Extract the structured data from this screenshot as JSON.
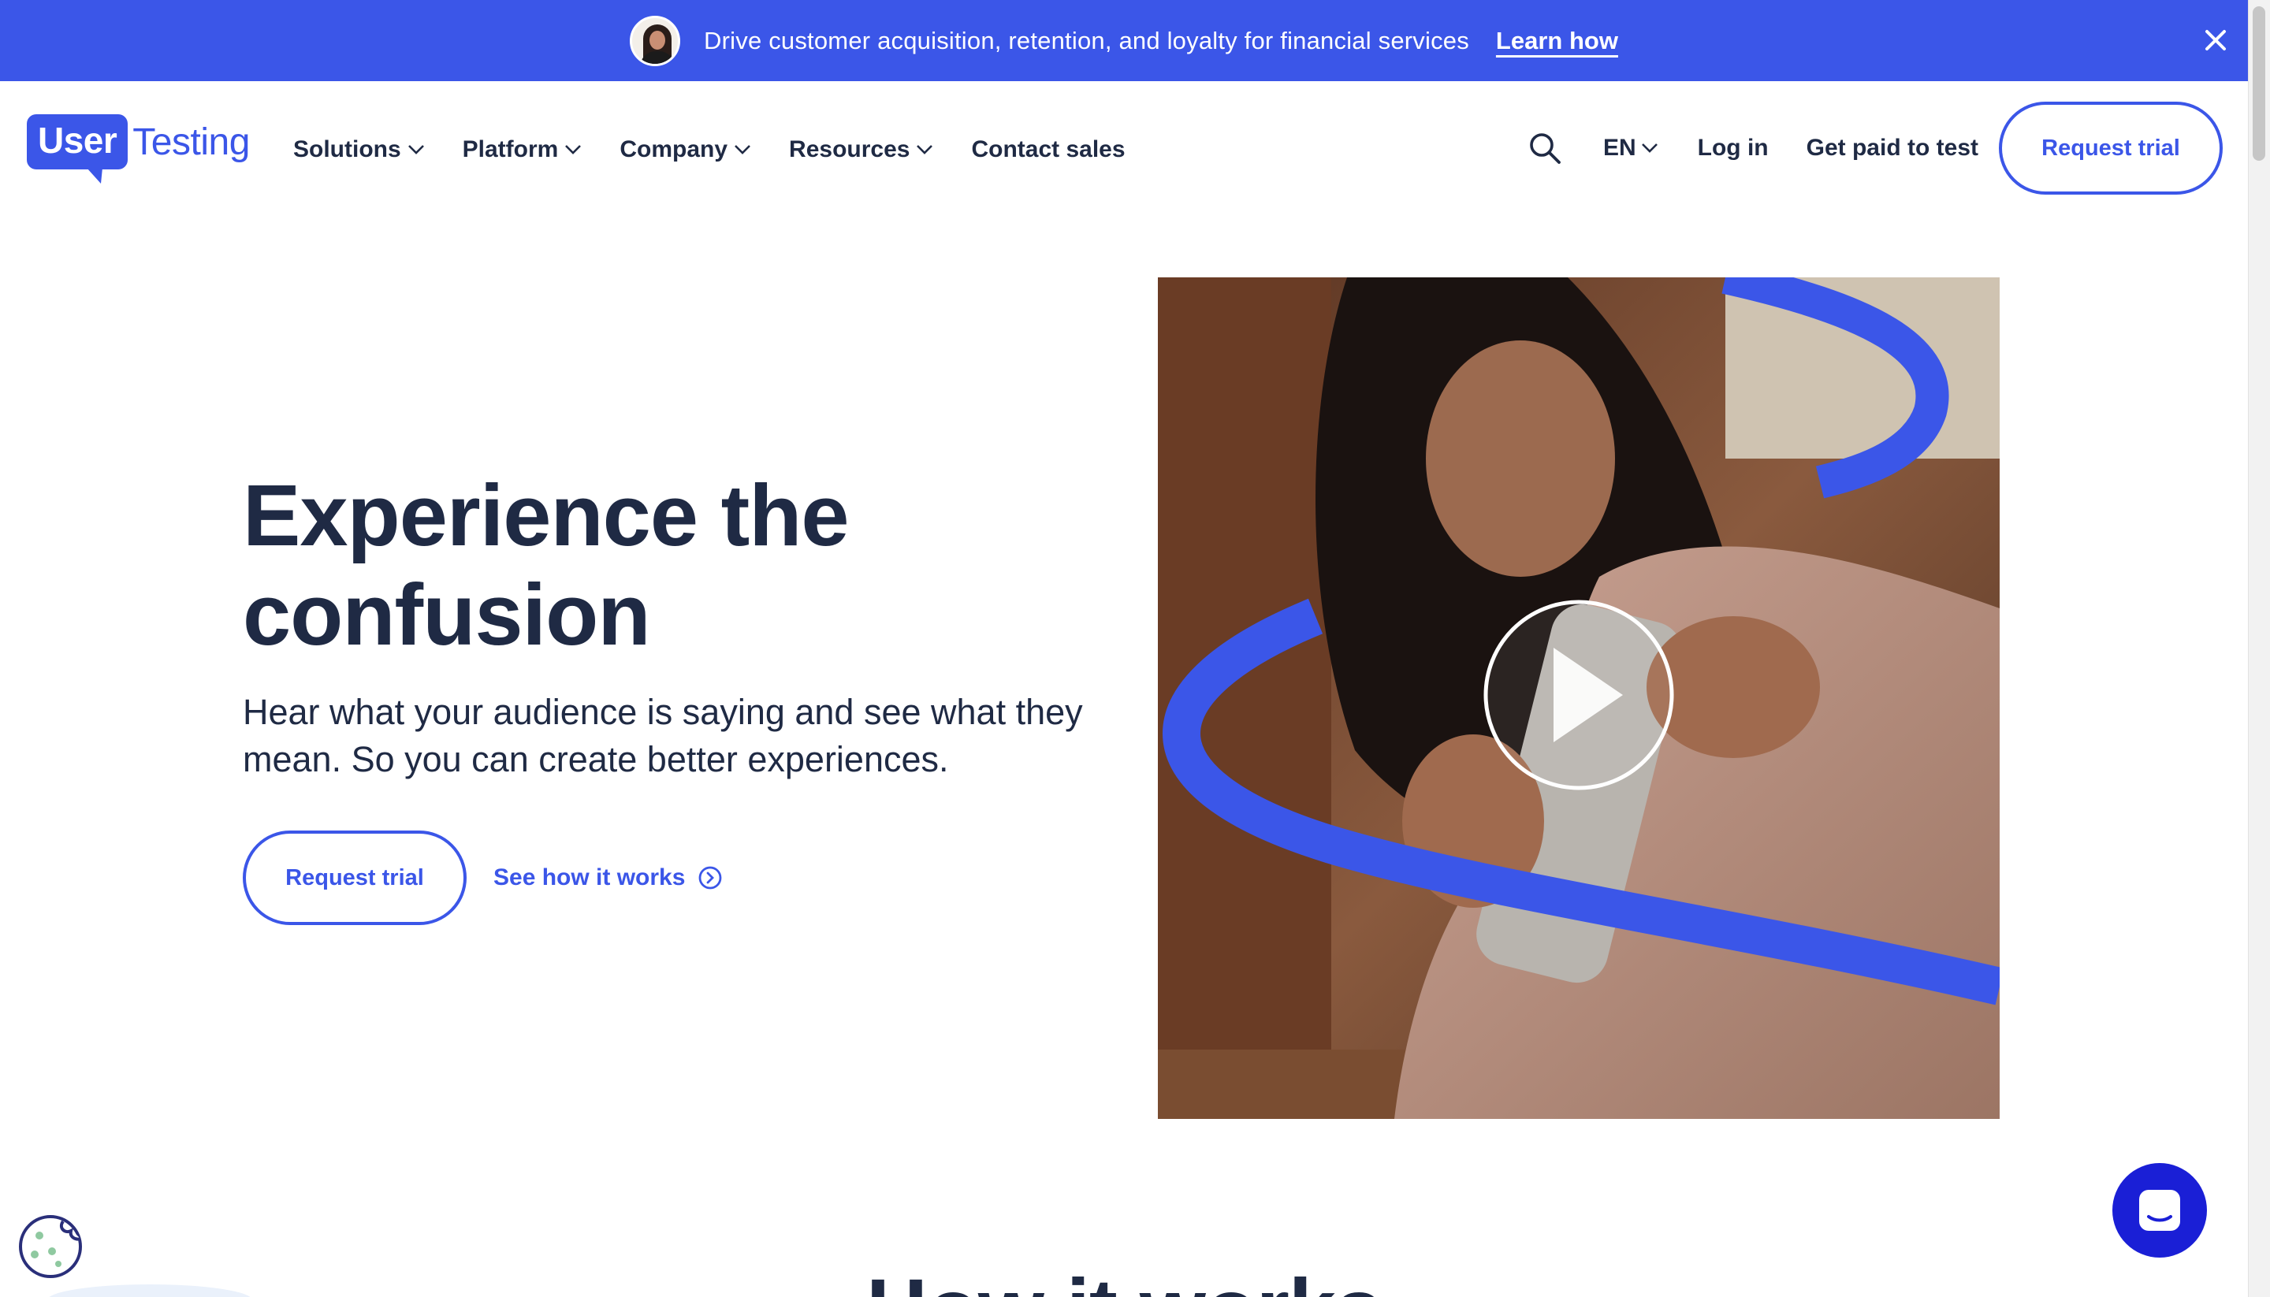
{
  "banner": {
    "text": "Drive customer acquisition, retention, and loyalty for financial services",
    "link": "Learn how"
  },
  "logo": {
    "part1": "User",
    "part2": "Testing"
  },
  "nav": {
    "items": [
      {
        "label": "Solutions",
        "dropdown": true
      },
      {
        "label": "Platform",
        "dropdown": true
      },
      {
        "label": "Company",
        "dropdown": true
      },
      {
        "label": "Resources",
        "dropdown": true
      },
      {
        "label": "Contact sales",
        "dropdown": false
      }
    ],
    "language": "EN",
    "login": "Log in",
    "get_paid": "Get paid to test",
    "request_trial": "Request trial"
  },
  "hero": {
    "title_line1": "Experience the",
    "title_line2": "confusion",
    "subtitle": "Hear what your audience is saying and see what they mean. So you can create better experiences.",
    "primary_button": "Request trial",
    "secondary_link": "See how it works"
  },
  "section": {
    "title": "How it works"
  },
  "colors": {
    "brand": "#3b56e8",
    "text": "#1f2a44",
    "chat": "#1a1fd6"
  },
  "icons": [
    "close-icon",
    "search-icon",
    "chevron-down-icon",
    "play-icon",
    "arrow-circle-right-icon",
    "cookie-icon",
    "chat-icon"
  ]
}
